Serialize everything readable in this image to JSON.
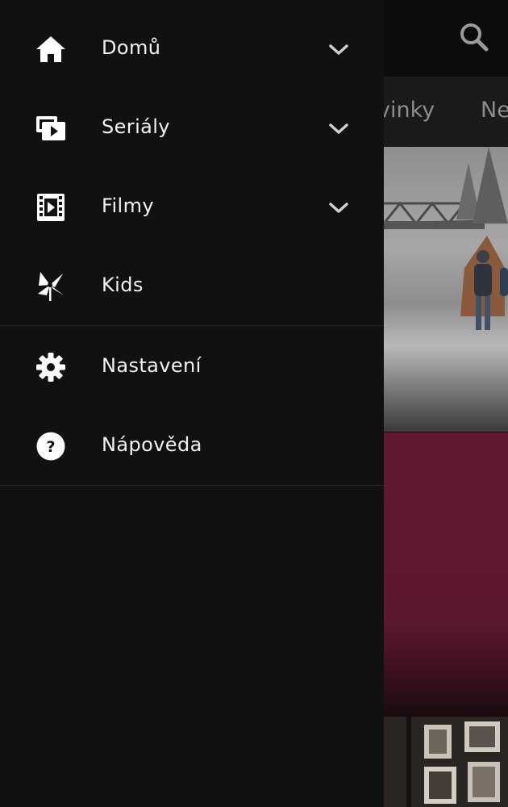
{
  "header": {
    "search_icon": "search-icon"
  },
  "tabs": [
    {
      "label": "vinky"
    },
    {
      "label": "Ne"
    }
  ],
  "drawer": {
    "items": [
      {
        "label": "Domů",
        "icon": "home-icon",
        "expandable": true
      },
      {
        "label": "Seriály",
        "icon": "tv-series-icon",
        "expandable": true
      },
      {
        "label": "Filmy",
        "icon": "film-icon",
        "expandable": true
      },
      {
        "label": "Kids",
        "icon": "pinwheel-icon",
        "expandable": false
      }
    ],
    "secondary_items": [
      {
        "label": "Nastavení",
        "icon": "gear-icon"
      },
      {
        "label": "Nápověda",
        "icon": "help-icon"
      }
    ]
  },
  "colors": {
    "drawer_bg": "#111111",
    "text": "#f2f2f2",
    "divider": "#262626",
    "tab_text": "#8c8c8c"
  }
}
